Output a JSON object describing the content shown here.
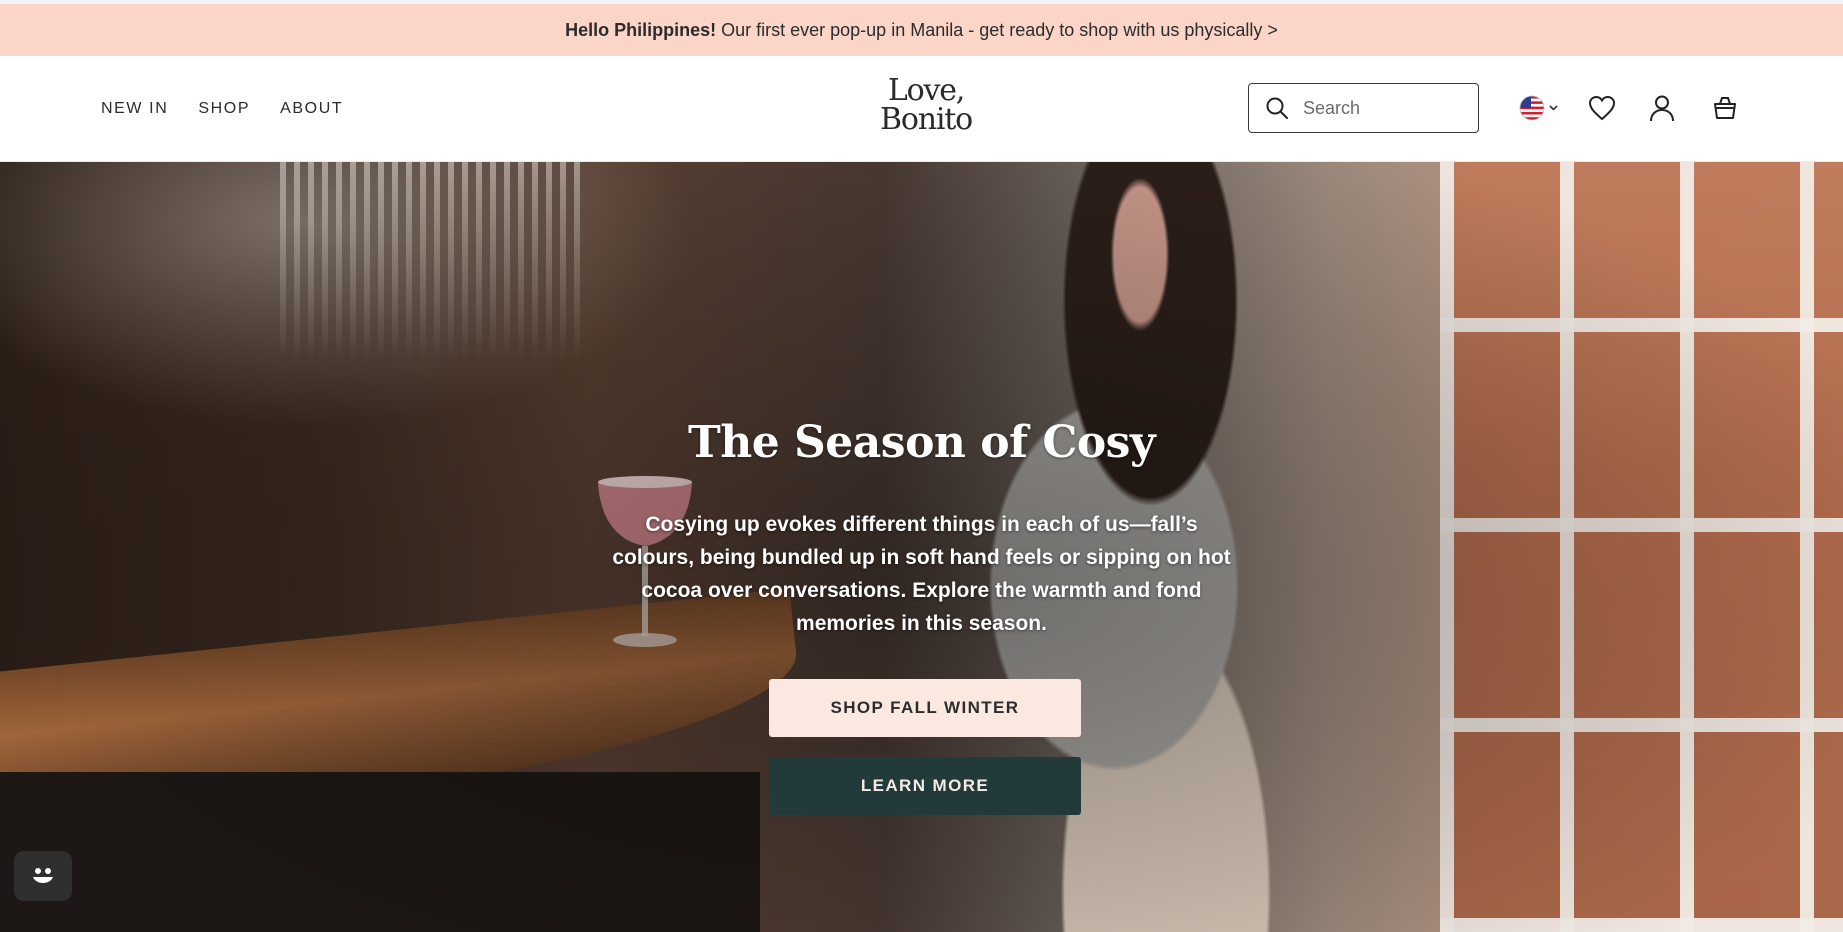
{
  "announcement": {
    "bold": "Hello Philippines!",
    "text": "Our first ever pop-up in Manila - get ready to shop with us physically >"
  },
  "nav": {
    "items": [
      "NEW IN",
      "SHOP",
      "ABOUT"
    ]
  },
  "logo": {
    "line1": "Love,",
    "line2": "Bonito"
  },
  "search": {
    "placeholder": "Search"
  },
  "header_icons": [
    "us-flag-icon",
    "heart-icon",
    "account-icon",
    "bag-icon"
  ],
  "hero": {
    "title": "The Season of Cosy",
    "description": "Cosying up evokes different things in each of us—fall’s colours, being bundled up in soft hand feels or sipping on hot cocoa over conversations. Explore the warmth and fond memories in this season.",
    "primary_button": "SHOP FALL WINTER",
    "secondary_button": "LEARN MORE"
  },
  "colors": {
    "announcement_bg": "#fbd5c7",
    "primary_button_bg": "#fae8e1",
    "secondary_button_bg": "#223b3a"
  }
}
